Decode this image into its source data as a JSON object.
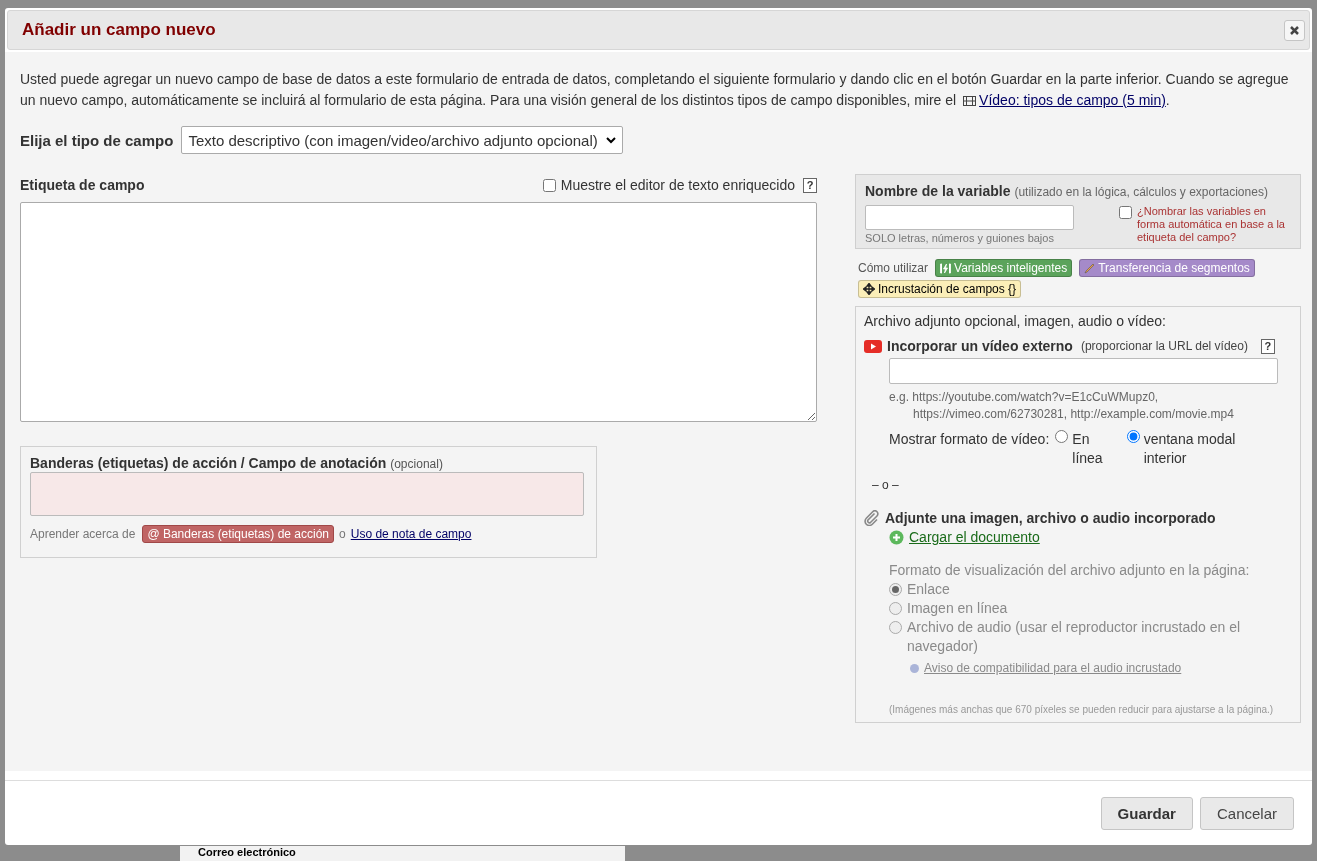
{
  "background": {
    "text": "Correo electrónico"
  },
  "dialog": {
    "title": "Añadir un campo nuevo"
  },
  "intro": {
    "text": "Usted puede agregar un nuevo campo de base de datos a este formulario de entrada de datos, completando el siguiente formulario y dando clic en el botón Guardar en la parte inferior. Cuando se agregue un nuevo campo, automáticamente se incluirá al formulario de esta página. Para una visión general de los distintos tipos de campo disponibles, mire el",
    "link": "Vídeo: tipos de campo (5 min)",
    "after": "."
  },
  "field_type": {
    "label": "Elija el tipo de campo",
    "value": "Texto descriptivo (con imagen/video/archivo adjunto opcional)"
  },
  "field_label": {
    "label": "Etiqueta de campo",
    "rich_text": {
      "label": "Muestre el editor de texto enriquecido",
      "checked": false
    },
    "help": "?"
  },
  "annotation": {
    "title": "Banderas (etiquetas) de acción / Campo de anotación",
    "optional": "(opcional)",
    "learn": "Aprender acerca de",
    "badge": "@ Banderas (etiquetas) de acción",
    "or": "o",
    "link": "Uso de nota de campo"
  },
  "variable": {
    "title": "Nombre de la variable",
    "note": "(utilizado en la lógica, cálculos y exportaciones)",
    "hint": "SOLO letras, números y guiones bajos",
    "auto_name": {
      "label": "¿Nombrar las variables en forma automática en base a la etiqueta del campo?",
      "checked": false
    }
  },
  "how_to": {
    "label": "Cómo utilizar",
    "badges": [
      {
        "kind": "bolt",
        "label": "Variables inteligentes",
        "color": "#5ba35b"
      },
      {
        "kind": "pipe",
        "label": "Transferencia de segmentos",
        "color": "#a58ac9"
      },
      {
        "kind": "move",
        "label": "Incrustación de campos {}",
        "color": "#fbeeb8"
      }
    ]
  },
  "attachment": {
    "title": "Archivo adjunto opcional, imagen, audio o vídeo:",
    "video": {
      "title": "Incorporar un vídeo externo",
      "note": "(proporcionar la URL del vídeo)",
      "help": "?",
      "examples": [
        "e.g. https://youtube.com/watch?v=E1cCuWMupz0,",
        "https://vimeo.com/62730281, http://example.com/movie.mp4"
      ],
      "display_label": "Mostrar formato de vídeo:",
      "options": [
        {
          "label": "En línea",
          "selected": false
        },
        {
          "label": "ventana modal interior",
          "selected": true
        }
      ]
    },
    "separator": "– o –",
    "upload": {
      "title": "Adjunte una imagen, archivo o audio incorporado",
      "link": "Cargar el documento"
    },
    "display_format": {
      "label": "Formato de visualización del archivo adjunto en la página:",
      "disabled": true,
      "options": [
        {
          "label": "Enlace",
          "selected": true
        },
        {
          "label": "Imagen en línea",
          "selected": false
        },
        {
          "label": "Archivo de audio (usar el reproductor incrustado en el navegador)",
          "selected": false
        }
      ]
    },
    "compat_link": "Aviso de compatibilidad para el audio incrustado",
    "note": "(Imágenes más anchas que 670 píxeles se pueden reducir para ajustarse a la página.)"
  },
  "buttons": [
    {
      "kind": "primary",
      "label": "Guardar"
    },
    {
      "kind": "secondary",
      "label": "Cancelar"
    }
  ]
}
